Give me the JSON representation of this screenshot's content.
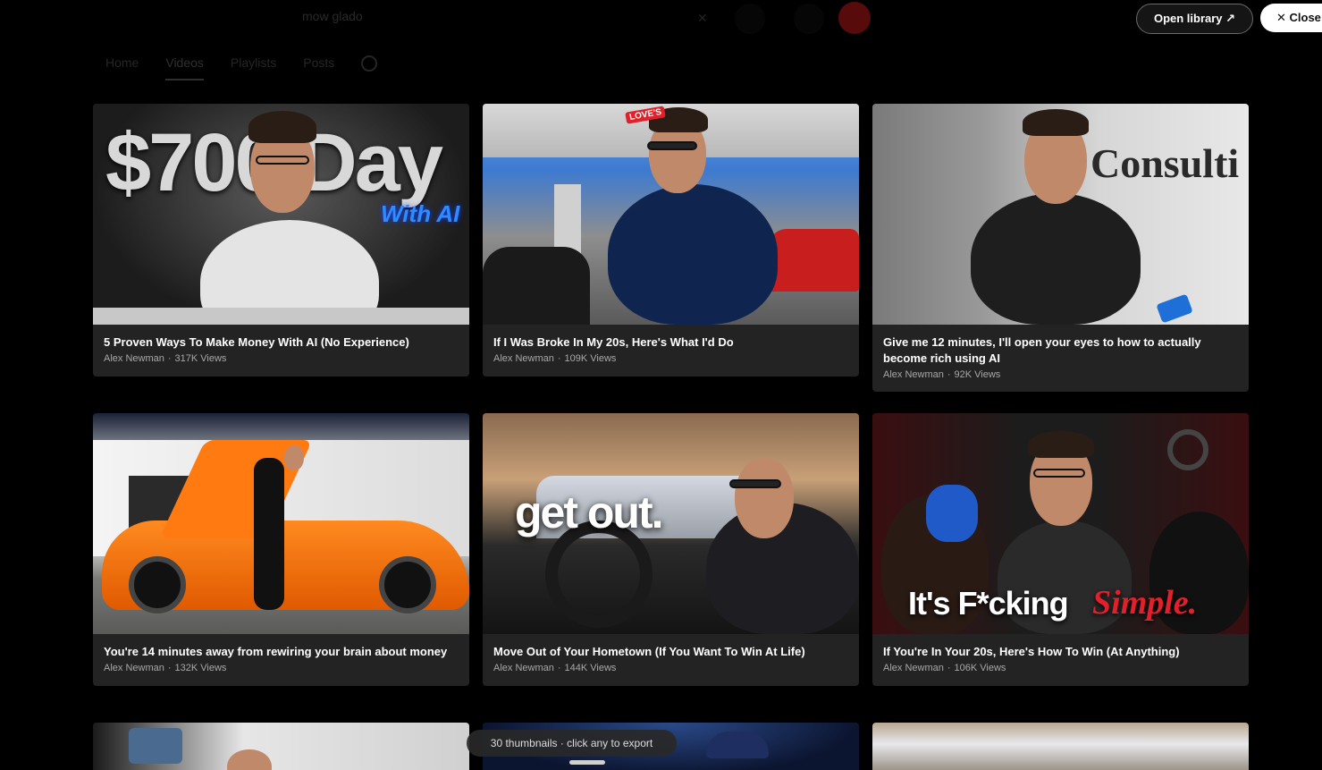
{
  "background_header": {
    "search_text": "mow glado",
    "tabs": [
      "Home",
      "Videos",
      "Playlists",
      "Posts"
    ],
    "active_tab": "Videos"
  },
  "toolbar": {
    "open_library_label": "Open library ↗",
    "close_label": "✕ Close"
  },
  "videos": [
    {
      "title": "5 Proven Ways To Make Money With AI (No Experience)",
      "channel": "Alex Newman",
      "views": "317K Views",
      "thumb_text": "$700/Day",
      "thumb_sub": "With AI"
    },
    {
      "title": "If I Was Broke In My 20s, Here's What I'd Do",
      "channel": "Alex Newman",
      "views": "109K Views",
      "thumb_text": "LOVE'S",
      "thumb_sub": ""
    },
    {
      "title": "Give me 12 minutes, I'll open your eyes to how to actually become rich using AI",
      "channel": "Alex Newman",
      "views": "92K Views",
      "thumb_text": "Consulti",
      "thumb_sub": ""
    },
    {
      "title": "You're 14 minutes away from rewiring your brain about money",
      "channel": "Alex Newman",
      "views": "132K Views",
      "thumb_text": "",
      "thumb_sub": ""
    },
    {
      "title": "Move Out of Your Hometown (If You Want To Win At Life)",
      "channel": "Alex Newman",
      "views": "144K Views",
      "thumb_text": "get out.",
      "thumb_sub": ""
    },
    {
      "title": "If You're In Your 20s, Here's How To Win (At Anything)",
      "channel": "Alex Newman",
      "views": "106K Views",
      "thumb_text": "It's F*cking",
      "thumb_sub": "Simple."
    }
  ],
  "footer": {
    "toast": "30 thumbnails · click any to export"
  },
  "colors": {
    "card_bg": "#232323",
    "accent_blue": "#2f8cff",
    "accent_red": "#e0202a"
  }
}
